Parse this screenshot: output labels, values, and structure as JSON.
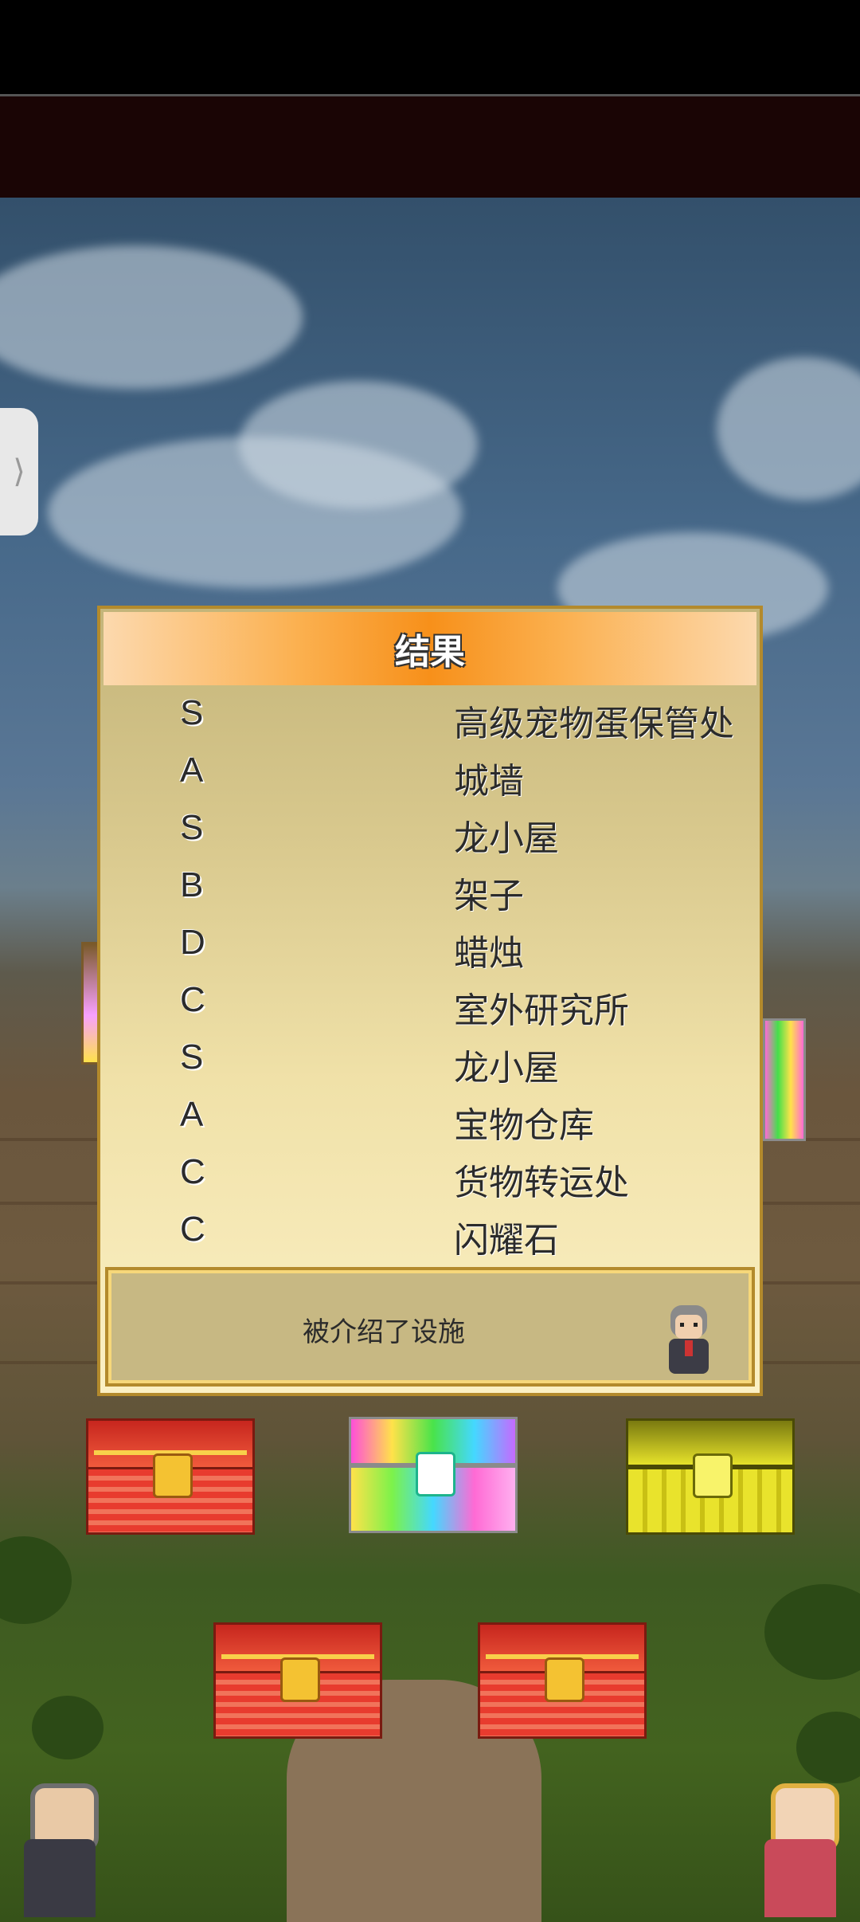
{
  "dialog": {
    "title": "结果",
    "results": [
      {
        "grade": "S",
        "name": "高级宠物蛋保管处"
      },
      {
        "grade": "A",
        "name": "城墙"
      },
      {
        "grade": "S",
        "name": "龙小屋"
      },
      {
        "grade": "B",
        "name": "架子"
      },
      {
        "grade": "D",
        "name": "蜡烛"
      },
      {
        "grade": "C",
        "name": "室外研究所"
      },
      {
        "grade": "S",
        "name": "龙小屋"
      },
      {
        "grade": "A",
        "name": "宝物仓库"
      },
      {
        "grade": "C",
        "name": "货物转运处"
      },
      {
        "grade": "C",
        "name": "闪耀石"
      }
    ],
    "message": "被介绍了设施"
  },
  "side_tab": {
    "icon": "chevron-right-icon",
    "glyph": "⟩"
  },
  "chests": [
    {
      "style": "red",
      "icon": "red-treasure-chest-icon"
    },
    {
      "style": "rainbow",
      "icon": "rainbow-treasure-chest-icon"
    },
    {
      "style": "gold",
      "icon": "gold-treasure-chest-icon"
    },
    {
      "style": "red",
      "icon": "red-treasure-chest-icon"
    },
    {
      "style": "red",
      "icon": "red-treasure-chest-icon"
    }
  ],
  "colors": {
    "header_orange": "#f7901a",
    "dialog_border": "#b38a2c",
    "chest_red": "#e83b2e",
    "chest_gold": "#e9e32c"
  }
}
